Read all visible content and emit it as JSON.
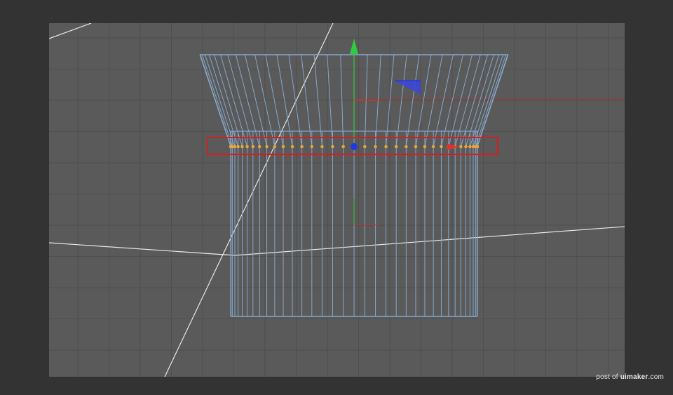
{
  "viewport": {
    "grid_visible": true,
    "colors": {
      "background": "#5a5a5a",
      "grid": "#4f4f4f",
      "wireframe": "#86a6c9",
      "point": "#e8a33a",
      "selection": "#e01a1a",
      "axis_x": "#d63030",
      "axis_y": "#2ecc40",
      "axis_z": "#2438e0",
      "guide": "#e8e8e8"
    },
    "object": {
      "type": "cylinder-wireframe",
      "segments": 36,
      "selected_ring_points": 36
    }
  },
  "watermark": {
    "prefix": "post of",
    "brand": "uimaker",
    "suffix": ".com"
  }
}
